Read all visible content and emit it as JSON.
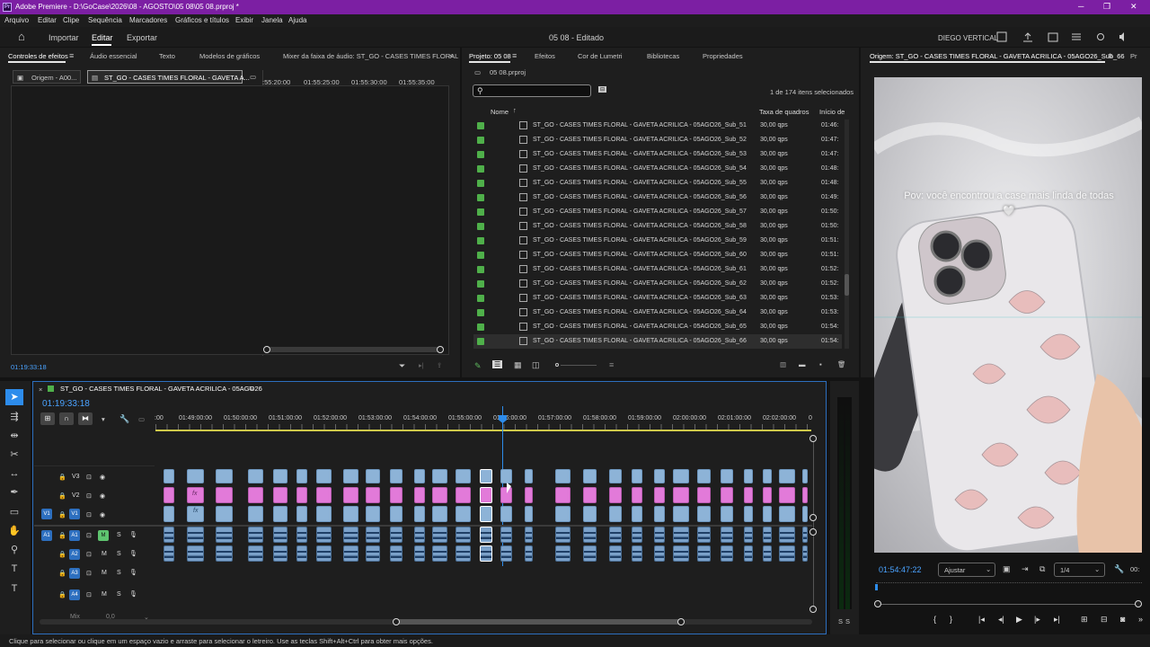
{
  "titlebar": {
    "app_icon": "Pr",
    "title": "Adobe Premiere - D:\\GoCase\\2026\\08 - AGOSTO\\05 08\\05 08.prproj *",
    "minimize": "─",
    "restore": "❐",
    "close": "✕"
  },
  "menu": [
    "Arquivo",
    "Editar",
    "Clipe",
    "Sequência",
    "Marcadores",
    "Gráficos e títulos",
    "Exibir",
    "Janela",
    "Ajuda"
  ],
  "nav": {
    "home": "⌂",
    "import": "Importar",
    "edit": "Editar",
    "export": "Exportar",
    "doc_title": "05 08 - Editado",
    "workspace": "DIEGO VERTICAL"
  },
  "effects_panel": {
    "tabs": [
      "Controles de efeitos",
      "Áudio essencial",
      "Texto",
      "Modelos de gráficos",
      "Mixer da faixa de áudio: ST_GO - CASES TIMES FLORAL"
    ],
    "source_btn": "Origem - A00...",
    "seq_btn": "ST_GO - CASES TIMES FLORAL - GAVETA A...",
    "ruler": [
      ":55:20:00",
      "01:55:25:00",
      "01:55:30:00",
      "01:55:35:00"
    ],
    "timecode": "01:19:33:18"
  },
  "project_panel": {
    "tabs": [
      "Projeto: 05 08",
      "Efeitos",
      "Cor de Lumetri",
      "Bibliotecas",
      "Propriedades"
    ],
    "file": "05 08.prproj",
    "selection_count": "1 de 174 itens selecionados",
    "columns": {
      "name": "Nome",
      "framerate": "Taxa de quadros",
      "start": "Início de"
    },
    "rows": [
      {
        "name": "ST_GO - CASES TIMES FLORAL - GAVETA ACRILICA - 05AGO26_Sub_51",
        "fps": "30,00 qps",
        "start": "01:46:"
      },
      {
        "name": "ST_GO - CASES TIMES FLORAL - GAVETA ACRILICA - 05AGO26_Sub_52",
        "fps": "30,00 qps",
        "start": "01:47:"
      },
      {
        "name": "ST_GO - CASES TIMES FLORAL - GAVETA ACRILICA - 05AGO26_Sub_53",
        "fps": "30,00 qps",
        "start": "01:47:"
      },
      {
        "name": "ST_GO - CASES TIMES FLORAL - GAVETA ACRILICA - 05AGO26_Sub_54",
        "fps": "30,00 qps",
        "start": "01:48:"
      },
      {
        "name": "ST_GO - CASES TIMES FLORAL - GAVETA ACRILICA - 05AGO26_Sub_55",
        "fps": "30,00 qps",
        "start": "01:48:"
      },
      {
        "name": "ST_GO - CASES TIMES FLORAL - GAVETA ACRILICA - 05AGO26_Sub_56",
        "fps": "30,00 qps",
        "start": "01:49:"
      },
      {
        "name": "ST_GO - CASES TIMES FLORAL - GAVETA ACRILICA - 05AGO26_Sub_57",
        "fps": "30,00 qps",
        "start": "01:50:"
      },
      {
        "name": "ST_GO - CASES TIMES FLORAL - GAVETA ACRILICA - 05AGO26_Sub_58",
        "fps": "30,00 qps",
        "start": "01:50:"
      },
      {
        "name": "ST_GO - CASES TIMES FLORAL - GAVETA ACRILICA - 05AGO26_Sub_59",
        "fps": "30,00 qps",
        "start": "01:51:"
      },
      {
        "name": "ST_GO - CASES TIMES FLORAL - GAVETA ACRILICA - 05AGO26_Sub_60",
        "fps": "30,00 qps",
        "start": "01:51:"
      },
      {
        "name": "ST_GO - CASES TIMES FLORAL - GAVETA ACRILICA - 05AGO26_Sub_61",
        "fps": "30,00 qps",
        "start": "01:52:"
      },
      {
        "name": "ST_GO - CASES TIMES FLORAL - GAVETA ACRILICA - 05AGO26_Sub_62",
        "fps": "30,00 qps",
        "start": "01:52:"
      },
      {
        "name": "ST_GO - CASES TIMES FLORAL - GAVETA ACRILICA - 05AGO26_Sub_63",
        "fps": "30,00 qps",
        "start": "01:53:"
      },
      {
        "name": "ST_GO - CASES TIMES FLORAL - GAVETA ACRILICA - 05AGO26_Sub_64",
        "fps": "30,00 qps",
        "start": "01:53:"
      },
      {
        "name": "ST_GO - CASES TIMES FLORAL - GAVETA ACRILICA - 05AGO26_Sub_65",
        "fps": "30,00 qps",
        "start": "01:54:"
      },
      {
        "name": "ST_GO - CASES TIMES FLORAL - GAVETA ACRILICA - 05AGO26_Sub_66",
        "fps": "30,00 qps",
        "start": "01:54:"
      }
    ]
  },
  "source_monitor": {
    "tab": "Origem: ST_GO - CASES TIMES FLORAL - GAVETA ACRILICA - 05AGO26_Sub_66",
    "tab2": "Pr",
    "overlay_text": "Pov: você encontrou a case mais linda de todas 🤍",
    "timecode": "01:54:47:22",
    "fit": "Ajustar",
    "resolution": "1/4",
    "end_tc": "00:"
  },
  "timeline": {
    "seq_name": "ST_GO - CASES TIMES FLORAL - GAVETA ACRILICA - 05AGO26",
    "timecode": "01:19:33:18",
    "ruler": [
      ":00",
      "01:49:00:00",
      "01:50:00:00",
      "01:51:00:00",
      "01:52:00:00",
      "01:53:00:00",
      "01:54:00:00",
      "01:55:00:00",
      "01:56:00:00",
      "01:57:00:00",
      "01:58:00:00",
      "01:59:00:00",
      "02:00:00:00",
      "02:01:00:00",
      "02:02:00:00",
      "0"
    ],
    "tracks": {
      "v3": "V3",
      "v2": "V2",
      "v1": "V1",
      "a1": "A1",
      "a2": "A2",
      "a3": "A3",
      "a4": "A4",
      "mix": "Mix",
      "mix_val": "0,0"
    },
    "m_label": "M",
    "s_label": "S",
    "fx_label": "fx"
  },
  "meter": {
    "s1": "S",
    "s2": "S"
  },
  "status": "Clique para selecionar ou clique em um espaço vazio e arraste para selecionar o letreiro. Use as teclas Shift+Alt+Ctrl para obter mais opções.",
  "colors": {
    "title_bar": "#7c1fa3",
    "accent_blue": "#2d8ceb",
    "clip_video": "#8db3d7",
    "clip_graphics": "#e27ad9",
    "label_green": "#4fb04a"
  }
}
